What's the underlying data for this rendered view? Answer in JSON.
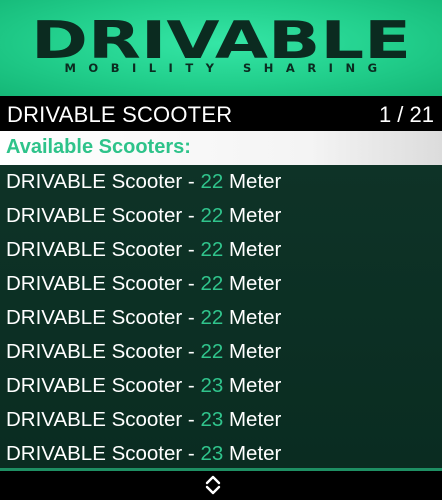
{
  "banner": {
    "logo_text": "DRIVABLE",
    "tagline": "MOBILITY SHARING",
    "color": "#22cf8c"
  },
  "header": {
    "title": "DRIVABLE SCOOTER",
    "count": "1 / 21"
  },
  "selected": {
    "label": "Available Scooters:",
    "color": "#2ec38a"
  },
  "items": [
    {
      "name": "DRIVABLE Scooter - ",
      "distance": "22",
      "unit": " Meter"
    },
    {
      "name": "DRIVABLE Scooter - ",
      "distance": "22",
      "unit": " Meter"
    },
    {
      "name": "DRIVABLE Scooter - ",
      "distance": "22",
      "unit": " Meter"
    },
    {
      "name": "DRIVABLE Scooter - ",
      "distance": "22",
      "unit": " Meter"
    },
    {
      "name": "DRIVABLE Scooter - ",
      "distance": "22",
      "unit": " Meter"
    },
    {
      "name": "DRIVABLE Scooter - ",
      "distance": "22",
      "unit": " Meter"
    },
    {
      "name": "DRIVABLE Scooter - ",
      "distance": "23",
      "unit": " Meter"
    },
    {
      "name": "DRIVABLE Scooter - ",
      "distance": "23",
      "unit": " Meter"
    },
    {
      "name": "DRIVABLE Scooter - ",
      "distance": "23",
      "unit": " Meter"
    }
  ],
  "footer": {
    "icon": "scroll-up-down-icon"
  }
}
